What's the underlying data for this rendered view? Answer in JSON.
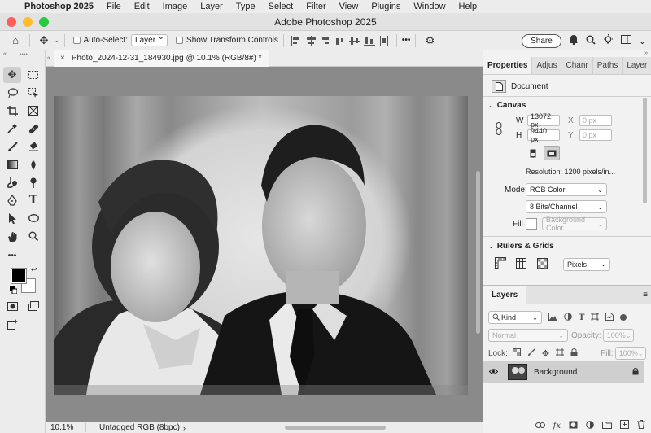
{
  "menubar": {
    "app": "Photoshop 2025",
    "items": [
      "File",
      "Edit",
      "Image",
      "Layer",
      "Type",
      "Select",
      "Filter",
      "View",
      "Plugins",
      "Window",
      "Help"
    ]
  },
  "window": {
    "title": "Adobe Photoshop 2025",
    "lights": [
      "#ff5f57",
      "#febc2e",
      "#28c840"
    ]
  },
  "options": {
    "auto_select_label": "Auto-Select:",
    "auto_select_value": "Layer",
    "transform_label": "Show Transform Controls",
    "share_label": "Share",
    "more_label": "•••"
  },
  "document": {
    "tab_title": "Photo_2024-12-31_184930.jpg @ 10.1% (RGB/8#) *",
    "close_glyph": "×"
  },
  "status": {
    "zoom": "10.1%",
    "info": "Untagged RGB (8bpc)"
  },
  "properties": {
    "tabs": [
      "Properties",
      "Adjus",
      "Chanr",
      "Paths",
      "Layer"
    ],
    "kind": "Document",
    "canvas_title": "Canvas",
    "w_label": "W",
    "w_value": "13072 px",
    "h_label": "H",
    "h_value": "9440 px",
    "x_label": "X",
    "x_value": "0 px",
    "y_label": "Y",
    "y_value": "0 px",
    "resolution": "Resolution: 1200 pixels/in...",
    "mode_label": "Mode",
    "mode_value": "RGB Color",
    "bits_value": "8 Bits/Channel",
    "fill_label": "Fill",
    "fill_value": "Background Color",
    "rulers_title": "Rulers & Grids",
    "units_value": "Pixels"
  },
  "layers": {
    "title": "Layers",
    "kind_label": "Kind",
    "blend_mode": "Normal",
    "opacity_label": "Opacity:",
    "opacity_value": "100%",
    "lock_label": "Lock:",
    "fill_label": "Fill:",
    "fill_value": "100%",
    "layer_name": "Background"
  }
}
